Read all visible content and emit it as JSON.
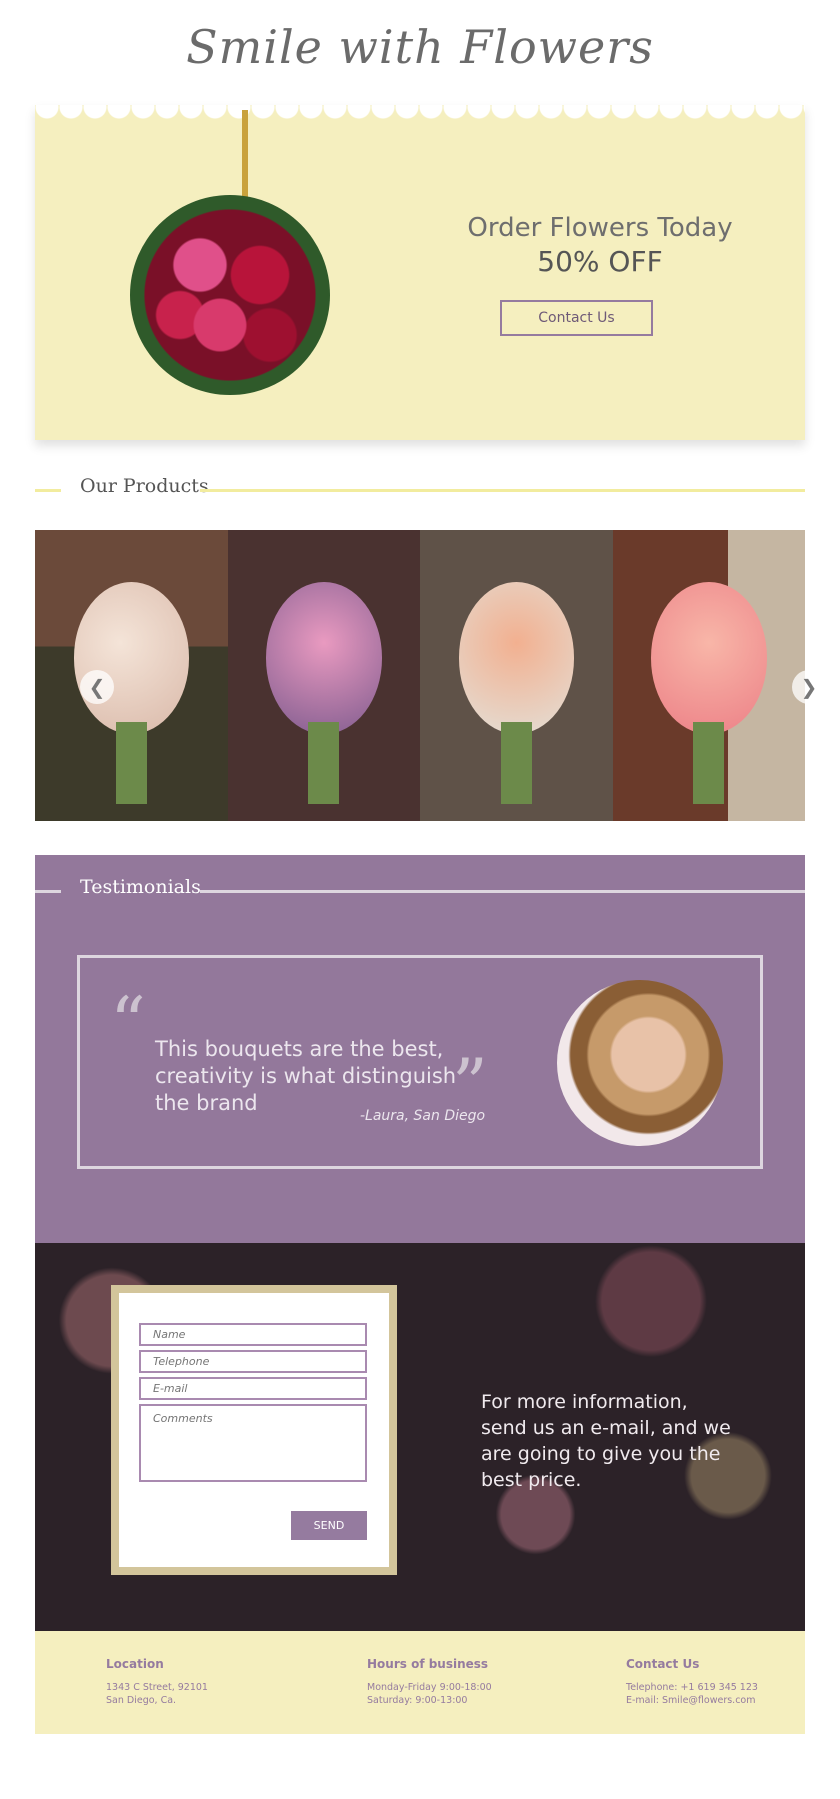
{
  "brand": {
    "logo": "Smile with Flowers"
  },
  "hero": {
    "title": "Order Flowers Today",
    "subtitle": "50% OFF",
    "cta": "Contact Us"
  },
  "products": {
    "heading": "Our Products",
    "prev_icon": "chevron-left-icon",
    "next_icon": "chevron-right-icon"
  },
  "testimonials": {
    "heading": "Testimonials",
    "quote": "This bouquets are the best, creativity is what distinguish the brand",
    "author": "-Laura, San Diego"
  },
  "contact_form": {
    "name_placeholder": "Name",
    "telephone_placeholder": "Telephone",
    "email_placeholder": "E-mail",
    "comments_placeholder": "Comments",
    "send_label": "SEND",
    "info_text": "For more information, send us an e-mail, and we are going to give you the best price."
  },
  "footer": {
    "location": {
      "title": "Location",
      "line1": "1343 C Street, 92101",
      "line2": "San Diego, Ca."
    },
    "hours": {
      "title": "Hours of business",
      "line1": "Monday-Friday 9:00-18:00",
      "line2": "Saturday: 9:00-13:00"
    },
    "contact": {
      "title": "Contact Us",
      "line1": "Telephone: +1 619 345 123",
      "line2": "E-mail: Smile@flowers.com"
    }
  },
  "colors": {
    "accent": "#957b9f",
    "cream": "#f5efbf",
    "text": "#6e6e6e"
  }
}
